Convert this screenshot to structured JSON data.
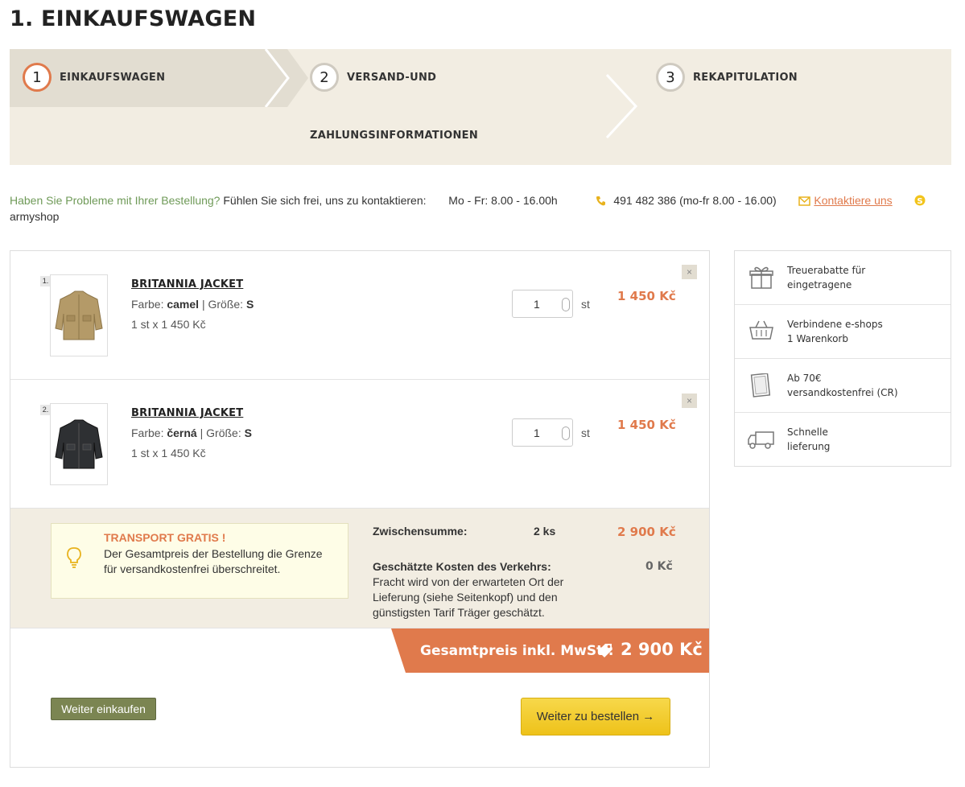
{
  "page_title": "1. EINKAUFSWAGEN",
  "steps": [
    {
      "num": "1",
      "label": "EINKAUFSWAGEN"
    },
    {
      "num": "2",
      "label": "VERSAND-UND",
      "label2": "ZAHLUNGSINFORMATIONEN"
    },
    {
      "num": "3",
      "label": "REKAPITULATION"
    }
  ],
  "contact": {
    "question": "Haben Sie Probleme mit Ihrer Bestellung?",
    "invite": "Fühlen Sie sich frei, uns zu kontaktieren:",
    "hours": "Mo - Fr: 8.00 - 16.00h",
    "phone": "491 482 386 (mo-fr 8.00 - 16.00)",
    "link": "Kontaktiere uns",
    "skype": "armyshop"
  },
  "items": [
    {
      "num": "1.",
      "name": "BRITANNIA JACKET",
      "color_label": "Farbe:",
      "color": "camel",
      "size_label": "Größe:",
      "size": "S",
      "unit_line": "1 st x 1 450 Kč",
      "qty": "1",
      "qty_unit": "st",
      "price": "1 450 Kč",
      "remove": "×",
      "image_color": "#b49a68"
    },
    {
      "num": "2.",
      "name": "BRITANNIA JACKET",
      "color_label": "Farbe:",
      "color": "černá",
      "size_label": "Größe:",
      "size": "S",
      "unit_line": "1 st x 1 450 Kč",
      "qty": "1",
      "qty_unit": "st",
      "price": "1 450 Kč",
      "remove": "×",
      "image_color": "#2e3033"
    }
  ],
  "notice": {
    "title": "TRANSPORT GRATIS !",
    "text": "Der Gesamtpreis der Bestellung die Grenze für versandkostenfrei überschreitet."
  },
  "summary": {
    "subtotal_label": "Zwischensumme:",
    "subtotal_count": "2 ks",
    "subtotal_price": "2 900 Kč",
    "shipping_label": "Geschätzte Kosten des Verkehrs:",
    "shipping_text": "Fracht wird von der erwarteten Ort der Lieferung (siehe Seitenkopf) und den günstigsten Tarif Träger geschätzt.",
    "shipping_price": "0 Kč"
  },
  "total": {
    "label": "Gesamtpreis inkl. MwSt.:",
    "value": "2 900 Kč"
  },
  "buttons": {
    "back": "Weiter einkaufen",
    "next": "Weiter zu bestellen →"
  },
  "benefits": [
    {
      "icon": "gift-icon",
      "line1": "Treuerabatte für",
      "line2": "eingetragene"
    },
    {
      "icon": "basket-icon",
      "line1": "Verbindene e-shops",
      "line2": "1 Warenkorb"
    },
    {
      "icon": "card-icon",
      "line1": " Ab 70€",
      "line2": "versandkostenfrei (CR)"
    },
    {
      "icon": "truck-icon",
      "line1": "Schnelle",
      "line2": "lieferung"
    }
  ],
  "colors": {
    "accent": "#e07a4c",
    "step_bg": "#f2ede2",
    "green": "#6f9a58",
    "button_olive": "#7b8552",
    "button_yellow": "#f2ca2a"
  }
}
